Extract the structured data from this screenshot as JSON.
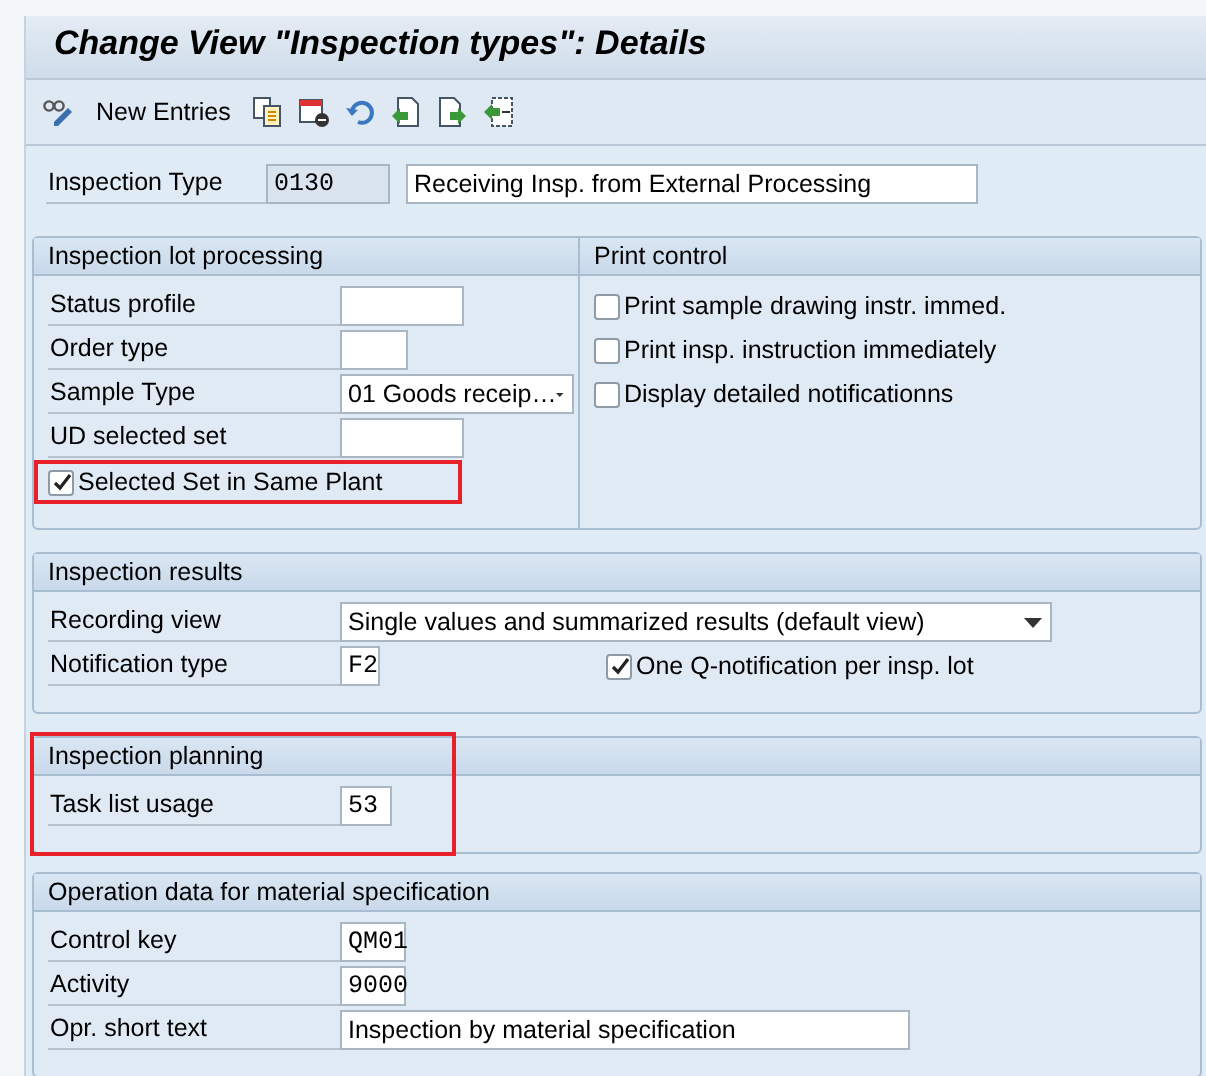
{
  "title": "Change View \"Inspection types\": Details",
  "toolbar": {
    "new_entries": "New Entries"
  },
  "header": {
    "label": "Inspection Type",
    "code": "0130",
    "description": "Receiving Insp. from External Processing"
  },
  "lot_processing": {
    "title": "Inspection lot processing",
    "fields": [
      {
        "kind": "input",
        "label": "Status profile"
      },
      {
        "kind": "input",
        "label": "Order type"
      },
      {
        "kind": "dropdown",
        "label": "Sample Type",
        "value": "01 Goods receip…"
      },
      {
        "kind": "input",
        "label": "UD selected set"
      },
      {
        "kind": "checkbox",
        "label": "Selected Set in Same Plant",
        "checked": true,
        "highlighted": true
      }
    ]
  },
  "print_control": {
    "title": "Print control",
    "options": [
      {
        "label": "Print sample drawing instr. immed.",
        "checked": false
      },
      {
        "label": "Print insp. instruction immediately",
        "checked": false
      },
      {
        "label": "Display detailed notificationns",
        "checked": false
      }
    ]
  },
  "inspection_results": {
    "title": "Inspection results",
    "recording_view": {
      "label": "Recording view",
      "value": "Single values and summarized results (default view)"
    },
    "notification_type": {
      "label": "Notification type",
      "value": "F2"
    },
    "one_notification": {
      "label": "One Q-notification per insp. lot",
      "checked": true
    }
  },
  "inspection_planning": {
    "title": "Inspection planning",
    "highlighted": true,
    "fields": [
      {
        "label": "Task list usage",
        "value": "53"
      }
    ]
  },
  "operation_data": {
    "title": "Operation data for material specification",
    "fields": [
      {
        "label": "Control key",
        "value": "QM01"
      },
      {
        "label": "Activity",
        "value": "9000"
      },
      {
        "label": "Opr. short text",
        "value": "Inspection by material specification"
      }
    ]
  }
}
